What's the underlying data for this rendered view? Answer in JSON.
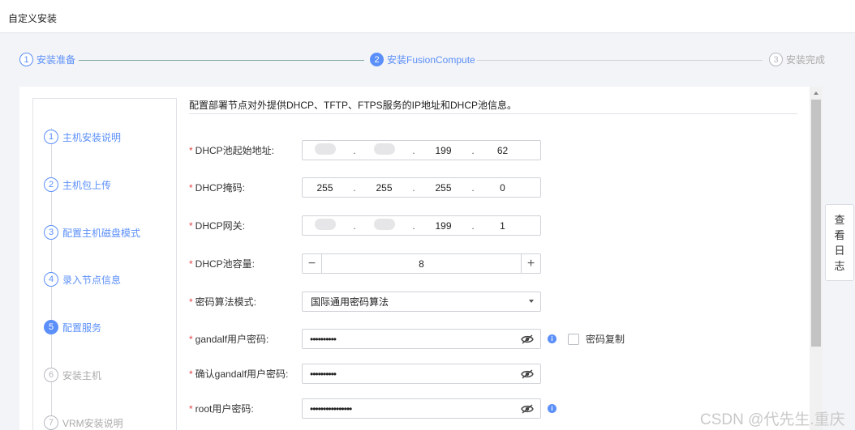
{
  "window": {
    "title": "自定义安装"
  },
  "wizard_steps": [
    {
      "num": "1",
      "label": "安装准备"
    },
    {
      "num": "2",
      "label": "安装FusionCompute"
    },
    {
      "num": "3",
      "label": "安装完成"
    }
  ],
  "left_nav": [
    {
      "num": "1",
      "label": "主机安装说明"
    },
    {
      "num": "2",
      "label": "主机包上传"
    },
    {
      "num": "3",
      "label": "配置主机磁盘模式"
    },
    {
      "num": "4",
      "label": "录入节点信息"
    },
    {
      "num": "5",
      "label": "配置服务"
    },
    {
      "num": "6",
      "label": "安装主机"
    },
    {
      "num": "7",
      "label": "VRM安装说明"
    }
  ],
  "description": "配置部署节点对外提供DHCP、TFTP、FTPS服务的IP地址和DHCP池信息。",
  "form": {
    "dhcp_start": {
      "label": "DHCP池起始地址:",
      "octets": [
        "",
        "",
        "199",
        "62"
      ]
    },
    "dhcp_mask": {
      "label": "DHCP掩码:",
      "octets": [
        "255",
        "255",
        "255",
        "0"
      ]
    },
    "dhcp_gateway": {
      "label": "DHCP网关:",
      "octets": [
        "",
        "",
        "199",
        "1"
      ]
    },
    "dhcp_capacity": {
      "label": "DHCP池容量:",
      "value": "8",
      "minus": "−",
      "plus": "+"
    },
    "crypto_mode": {
      "label": "密码算法模式:",
      "value": "国际通用密码算法"
    },
    "gandalf_pwd": {
      "label": "gandalf用户密码:",
      "value": "••••••••••",
      "info": "i",
      "copy_label": "密码复制"
    },
    "gandalf_confirm": {
      "label": "确认gandalf用户密码:",
      "value": "••••••••••"
    },
    "root_pwd": {
      "label": "root用户密码:",
      "value": "••••••••••••••••",
      "info": "i"
    }
  },
  "required_mark": "*",
  "view_log": [
    "查",
    "看",
    "日",
    "志"
  ],
  "watermark": "CSDN @代先生.重庆",
  "colors": {
    "accent": "#5b8ff9",
    "required": "#e54545",
    "line_done": "#7fa7a0",
    "line_todo": "#cfd2d8"
  }
}
